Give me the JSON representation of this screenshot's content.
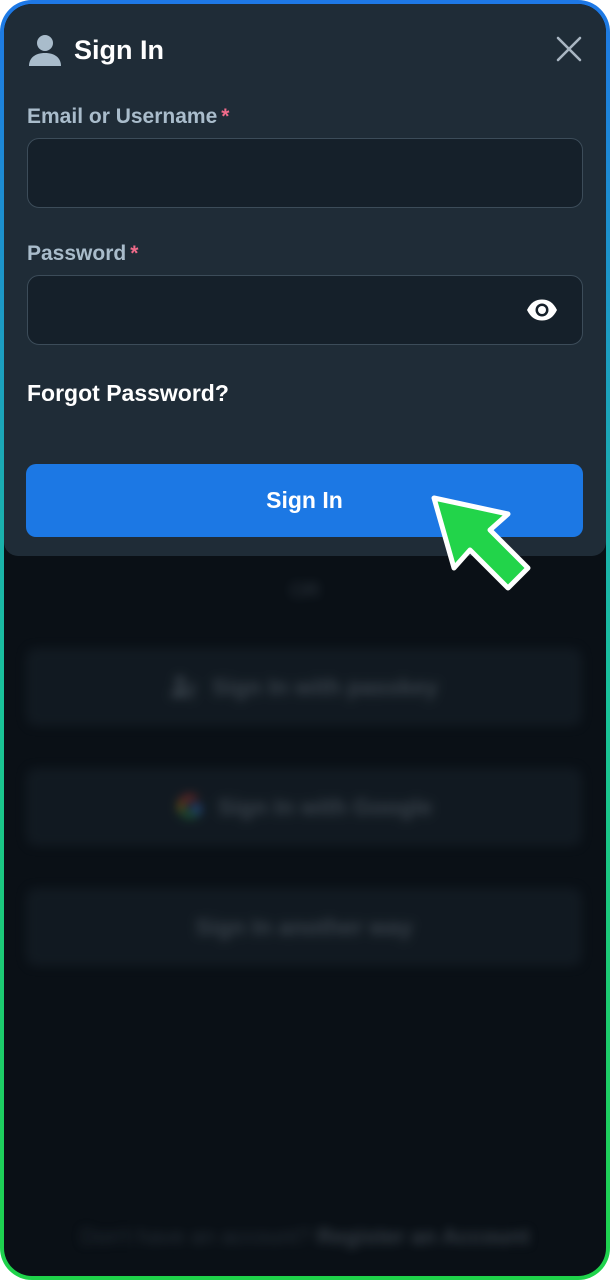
{
  "modal": {
    "title": "Sign In",
    "email_label": "Email or Username",
    "password_label": "Password",
    "required_mark": "*",
    "email_value": "",
    "password_value": "",
    "forgot_label": "Forgot Password?",
    "signin_label": "Sign In"
  },
  "alternatives": {
    "or_label": "OR",
    "passkey_label": "Sign In with passkey",
    "google_label": "Sign In with Google",
    "another_way_label": "Sign In another way"
  },
  "footer": {
    "prompt": "Don't have an account?",
    "register_label": "Register an Account"
  },
  "colors": {
    "modal_bg": "#1f2c37",
    "primary_button": "#1c78e4",
    "required_asterisk": "#f06b8a",
    "label_text": "#a9bccb",
    "pointer_green": "#22d44a"
  },
  "icons": {
    "title": "user-icon",
    "close": "close-icon",
    "password_toggle": "eye-icon",
    "passkey": "passkey-icon",
    "google": "google-icon",
    "pointer": "cursor-arrow-icon"
  }
}
